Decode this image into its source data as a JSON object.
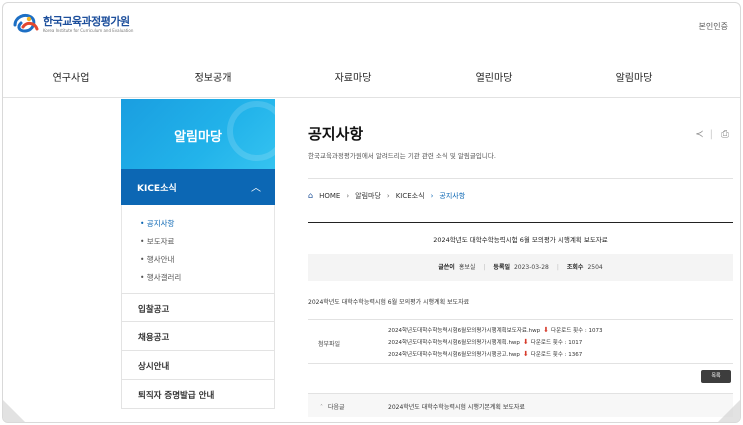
{
  "header": {
    "logo_ko": "한국교육과정평가원",
    "logo_en": "Korea Institute for Curriculum and Evaluation",
    "cert_link": "본인인증"
  },
  "gnb": [
    "연구사업",
    "정보공개",
    "자료마당",
    "열린마당",
    "알림마당"
  ],
  "sidebar": {
    "title": "알림마당",
    "active_section": "KICE소식",
    "subitems": [
      {
        "label": "• 공지사항",
        "active": true
      },
      {
        "label": "• 보도자료",
        "active": false
      },
      {
        "label": "• 행사안내",
        "active": false
      },
      {
        "label": "• 행사갤러리",
        "active": false
      }
    ],
    "items": [
      "입찰공고",
      "채용공고",
      "상시안내",
      "퇴직자 증명발급 안내"
    ]
  },
  "page": {
    "title": "공지사항",
    "description": "한국교육과정평가원에서 알려드리는 기관 관련 소식 및 알림글입니다.",
    "breadcrumb": [
      "HOME",
      "알림마당",
      "KICE소식",
      "공지사항"
    ]
  },
  "post": {
    "title": "2024학년도 대학수학능력시험 6월 모의평가 시행계획 보도자료",
    "author_label": "글쓴이",
    "author": "홍보실",
    "date_label": "등록일",
    "date": "2023-03-28",
    "views_label": "조회수",
    "views": "2504",
    "body": "2024학년도 대학수학능력시험 6월 모의평가 시행계획 보도자료",
    "attachments_label": "첨부파일",
    "attachments": [
      {
        "name": "2024학년도대학수학능력시험6월모의평가시행계획보도자료.hwp",
        "downloads": "다운로드 횟수 : 1073"
      },
      {
        "name": "2024학년도대학수학능력시험6월모의평가시행계획.hwp",
        "downloads": "다운로드 횟수 : 1017"
      },
      {
        "name": "2024학년도대학수학능력시험6월모의평가시행공고.hwp",
        "downloads": "다운로드 횟수 : 1367"
      }
    ],
    "list_button": "목록",
    "next_label": "다음글",
    "next_title": "2024학년도 대학수학능력시험 시행기본계획 보도자료"
  },
  "colors": {
    "brand_blue": "#0c67b4",
    "sidebar_head": "#1a9ee0",
    "download_icon": "#d63a2a"
  },
  "icons": [
    "share-icon",
    "print-icon",
    "home-icon",
    "chevron-up-icon",
    "download-icon"
  ]
}
